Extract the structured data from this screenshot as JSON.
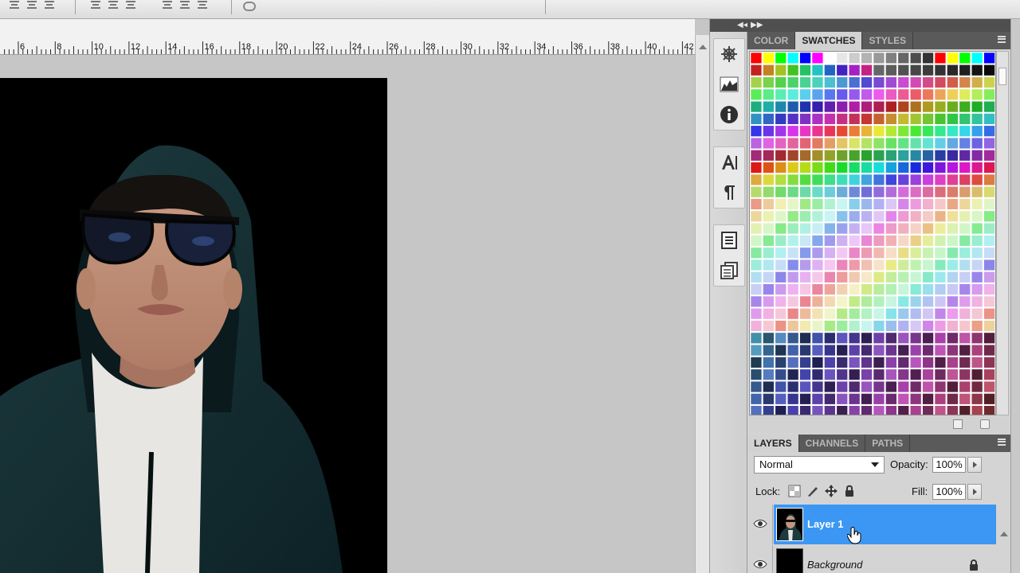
{
  "ruler": {
    "labels": [
      "6",
      "8",
      "10",
      "12",
      "14",
      "16",
      "18",
      "20",
      "22",
      "24",
      "26",
      "28",
      "30",
      "32",
      "34",
      "36",
      "38",
      "40",
      "42"
    ]
  },
  "dock": {
    "icons": [
      "navigator-icon",
      "histogram-icon",
      "info-icon",
      "character-icon",
      "paragraph-icon",
      "notes-icon",
      "clone-source-icon"
    ]
  },
  "swatches_panel": {
    "tabs": [
      {
        "label": "COLOR",
        "active": false
      },
      {
        "label": "SWATCHES",
        "active": true
      },
      {
        "label": "STYLES",
        "active": false
      }
    ]
  },
  "layers_panel": {
    "tabs": [
      {
        "label": "LAYERS",
        "active": true
      },
      {
        "label": "CHANNELS",
        "active": false
      },
      {
        "label": "PATHS",
        "active": false
      }
    ],
    "blend_mode": "Normal",
    "opacity_label": "Opacity:",
    "opacity_value": "100%",
    "lock_label": "Lock:",
    "fill_label": "Fill:",
    "fill_value": "100%",
    "layers": [
      {
        "name": "Layer 1",
        "selected": true,
        "visible": true,
        "locked": false
      },
      {
        "name": "Background",
        "selected": false,
        "visible": true,
        "locked": true
      }
    ]
  },
  "colors": {
    "selection": "#3b97f3",
    "panel_tab_bar": "#5a5a5a"
  }
}
